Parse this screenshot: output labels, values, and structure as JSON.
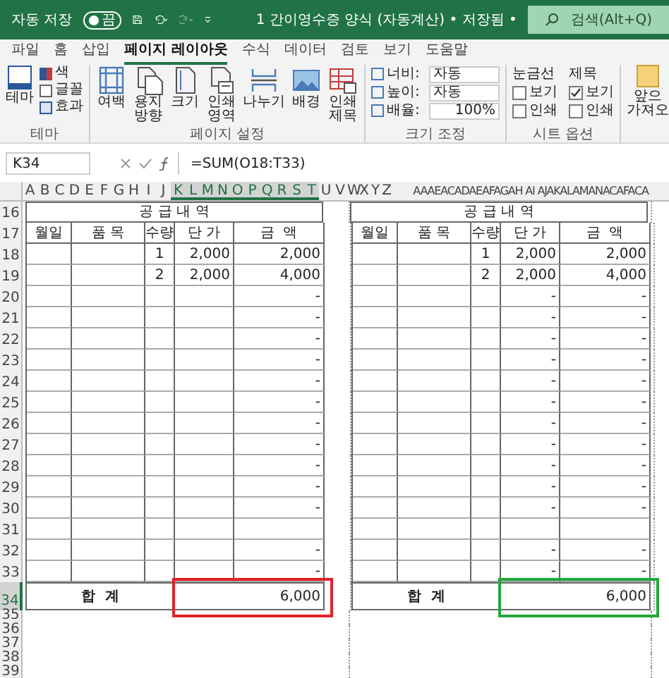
{
  "title_bar": {
    "autosave_label": "자동 저장",
    "autosave_state": "끔",
    "autosave_on": false,
    "document_title": "1 간이영수증 양식 (자동계산) • 저장됨 •",
    "search_placeholder": "검색(Alt+Q)"
  },
  "ribbon_tabs": [
    {
      "label": "파일",
      "selected": false
    },
    {
      "label": "홈",
      "selected": false
    },
    {
      "label": "삽입",
      "selected": false
    },
    {
      "label": "페이지 레이아웃",
      "selected": true
    },
    {
      "label": "수식",
      "selected": false
    },
    {
      "label": "데이터",
      "selected": false
    },
    {
      "label": "검토",
      "selected": false
    },
    {
      "label": "보기",
      "selected": false
    },
    {
      "label": "도움말",
      "selected": false
    }
  ],
  "ribbon": {
    "theme_group": {
      "label": "테마",
      "big_button": "테마",
      "small_buttons": [
        "색",
        "글꼴",
        "효과"
      ]
    },
    "page_setup": {
      "label": "페이지 설정",
      "buttons": [
        [
          "여백"
        ],
        [
          "용지",
          "방향"
        ],
        [
          "크기"
        ],
        [
          "인쇄",
          "영역"
        ],
        [
          "나누기"
        ],
        [
          "배경"
        ],
        [
          "인쇄",
          "제목"
        ]
      ]
    },
    "scale": {
      "label": "크기 조정",
      "fields": [
        {
          "label": "너비:",
          "value": "자동"
        },
        {
          "label": "높이:",
          "value": "자동"
        },
        {
          "label": "배율:",
          "value": "100%"
        }
      ]
    },
    "sheet_options": {
      "label": "시트 옵션",
      "columns": [
        {
          "title": "눈금선",
          "options": [
            {
              "label": "보기",
              "checked": false
            },
            {
              "label": "인쇄",
              "checked": false
            }
          ]
        },
        {
          "title": "제목",
          "options": [
            {
              "label": "보기",
              "checked": true
            },
            {
              "label": "인쇄",
              "checked": false
            }
          ]
        }
      ]
    },
    "cut_button": [
      "앞으",
      "가져오"
    ]
  },
  "formula_bar": {
    "name_box": "K34",
    "formula": "=SUM(O18:T33)"
  },
  "sheet": {
    "column_headers": [
      {
        "label": "A",
        "selected": false
      },
      {
        "label": "B",
        "selected": false
      },
      {
        "label": "C",
        "selected": false
      },
      {
        "label": "D",
        "selected": false
      },
      {
        "label": "E",
        "selected": false
      },
      {
        "label": "F",
        "selected": false
      },
      {
        "label": "G",
        "selected": false
      },
      {
        "label": "H",
        "selected": false
      },
      {
        "label": "I",
        "selected": false
      },
      {
        "label": "J",
        "selected": false
      },
      {
        "label": "K",
        "selected": true
      },
      {
        "label": "L",
        "selected": true
      },
      {
        "label": "M",
        "selected": true
      },
      {
        "label": "N",
        "selected": true
      },
      {
        "label": "O",
        "selected": true
      },
      {
        "label": "P",
        "selected": true
      },
      {
        "label": "Q",
        "selected": true
      },
      {
        "label": "R",
        "selected": true
      },
      {
        "label": "S",
        "selected": true
      },
      {
        "label": "T",
        "selected": true
      },
      {
        "label": "U",
        "selected": false
      },
      {
        "label": "V",
        "selected": false
      },
      {
        "label": "W",
        "selected": false
      },
      {
        "label": "X",
        "selected": false
      },
      {
        "label": "Y",
        "selected": false
      },
      {
        "label": "Z",
        "selected": false
      },
      {
        "label": "AAAEACADAEAFAGAH AI AJAKALAMANACAFACA",
        "selected": false
      }
    ],
    "row_numbers": [
      {
        "label": "16",
        "selected": false
      },
      {
        "label": "17",
        "selected": false
      },
      {
        "label": "18",
        "selected": false
      },
      {
        "label": "19",
        "selected": false
      },
      {
        "label": "20",
        "selected": false
      },
      {
        "label": "21",
        "selected": false
      },
      {
        "label": "22",
        "selected": false
      },
      {
        "label": "23",
        "selected": false
      },
      {
        "label": "24",
        "selected": false
      },
      {
        "label": "25",
        "selected": false
      },
      {
        "label": "26",
        "selected": false
      },
      {
        "label": "27",
        "selected": false
      },
      {
        "label": "28",
        "selected": false
      },
      {
        "label": "29",
        "selected": false
      },
      {
        "label": "30",
        "selected": false
      },
      {
        "label": "31",
        "selected": false
      },
      {
        "label": "32",
        "selected": false
      },
      {
        "label": "33",
        "selected": false
      },
      {
        "label": "34",
        "selected": true
      },
      {
        "label": "35",
        "selected": false
      },
      {
        "label": "36",
        "selected": false
      },
      {
        "label": "37",
        "selected": false
      },
      {
        "label": "38",
        "selected": false
      },
      {
        "label": "39",
        "selected": false
      }
    ],
    "tables": [
      {
        "title": "공 급 내 역",
        "headers": [
          "월일",
          "품 목",
          "수량",
          "단 가",
          "금  액"
        ],
        "total_label": "합  계",
        "total": "6,000",
        "color": "#e4202a",
        "rows": [
          [
            "",
            "",
            "1",
            "2,000",
            "2,000"
          ],
          [
            "",
            "",
            "2",
            "2,000",
            "4,000"
          ],
          [
            "",
            "",
            "",
            "",
            "-"
          ],
          [
            "",
            "",
            "",
            "",
            "-"
          ],
          [
            "",
            "",
            "",
            "",
            "-"
          ],
          [
            "",
            "",
            "",
            "",
            "-"
          ],
          [
            "",
            "",
            "",
            "",
            "-"
          ],
          [
            "",
            "",
            "",
            "",
            "-"
          ],
          [
            "",
            "",
            "",
            "",
            "-"
          ],
          [
            "",
            "",
            "",
            "",
            "-"
          ],
          [
            "",
            "",
            "",
            "",
            "-"
          ],
          [
            "",
            "",
            "",
            "",
            "-"
          ],
          [
            "",
            "",
            "",
            "",
            "-"
          ],
          [
            "",
            "",
            "",
            "",
            ""
          ],
          [
            "",
            "",
            "",
            "",
            "-"
          ],
          [
            "",
            "",
            "",
            "",
            "-"
          ]
        ]
      },
      {
        "title": "공 급 내 역",
        "headers": [
          "월일",
          "품 목",
          "수량",
          "단 가",
          "금  액"
        ],
        "total_label": "합  계",
        "total": "6,000",
        "color": "#22a83c",
        "rows": [
          [
            "",
            "",
            "1",
            "2,000",
            "2,000"
          ],
          [
            "",
            "",
            "2",
            "2,000",
            "4,000"
          ],
          [
            "",
            "",
            "",
            "-",
            "-"
          ],
          [
            "",
            "",
            "",
            "-",
            "-"
          ],
          [
            "",
            "",
            "",
            "-",
            "-"
          ],
          [
            "",
            "",
            "",
            "-",
            "-"
          ],
          [
            "",
            "",
            "",
            "-",
            "-"
          ],
          [
            "",
            "",
            "",
            "-",
            "-"
          ],
          [
            "",
            "",
            "",
            "-",
            "-"
          ],
          [
            "",
            "",
            "",
            "-",
            "-"
          ],
          [
            "",
            "",
            "",
            "-",
            "-"
          ],
          [
            "",
            "",
            "",
            "-",
            "-"
          ],
          [
            "",
            "",
            "",
            "-",
            "-"
          ],
          [
            "",
            "",
            "",
            "",
            ""
          ],
          [
            "",
            "",
            "",
            "-",
            "-"
          ],
          [
            "",
            "",
            "",
            "-",
            "-"
          ]
        ]
      }
    ]
  }
}
